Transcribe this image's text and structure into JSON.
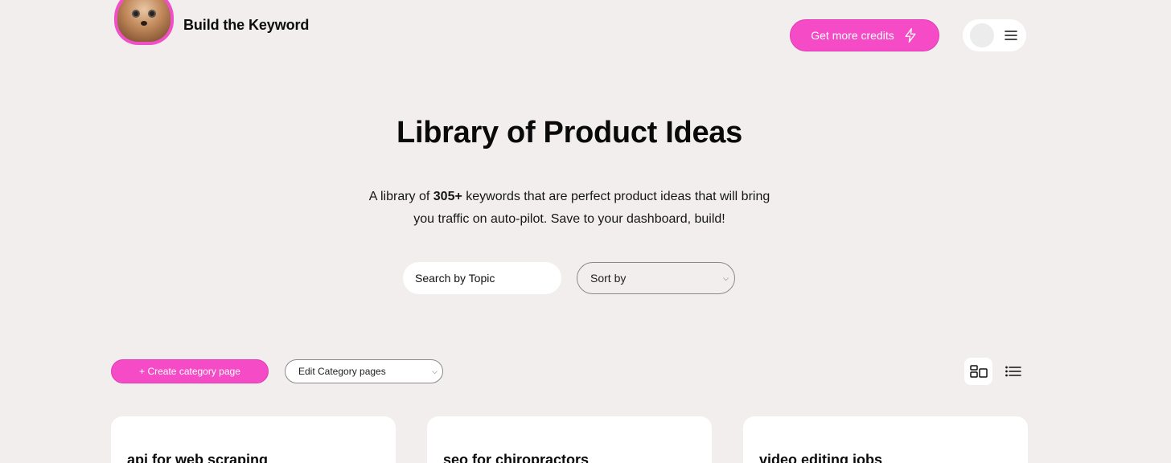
{
  "header": {
    "brand": "Build the Keyword",
    "credits_label": "Get more credits"
  },
  "hero": {
    "title": "Library of Product Ideas",
    "subtitle_before": "A library of ",
    "subtitle_count": "305+",
    "subtitle_after_line1": " keywords that are perfect product ideas that will bring",
    "subtitle_line2": "you traffic on auto-pilot. Save to your dashboard, build!"
  },
  "filters": {
    "search_placeholder": "Search by Topic",
    "sort_label": "Sort by"
  },
  "toolbar": {
    "create_label": "+ Create category page",
    "edit_label": "Edit Category pages"
  },
  "cards": [
    {
      "title": "api for web scraping"
    },
    {
      "title": "seo for chiropractors"
    },
    {
      "title": "video editing jobs"
    }
  ],
  "colors": {
    "accent": "#f54bc7",
    "background": "#f1eeed"
  },
  "icons": {
    "credits": "lightning-icon",
    "menu": "hamburger-icon",
    "grid_view": "grid-view-icon",
    "list_view": "list-view-icon"
  }
}
